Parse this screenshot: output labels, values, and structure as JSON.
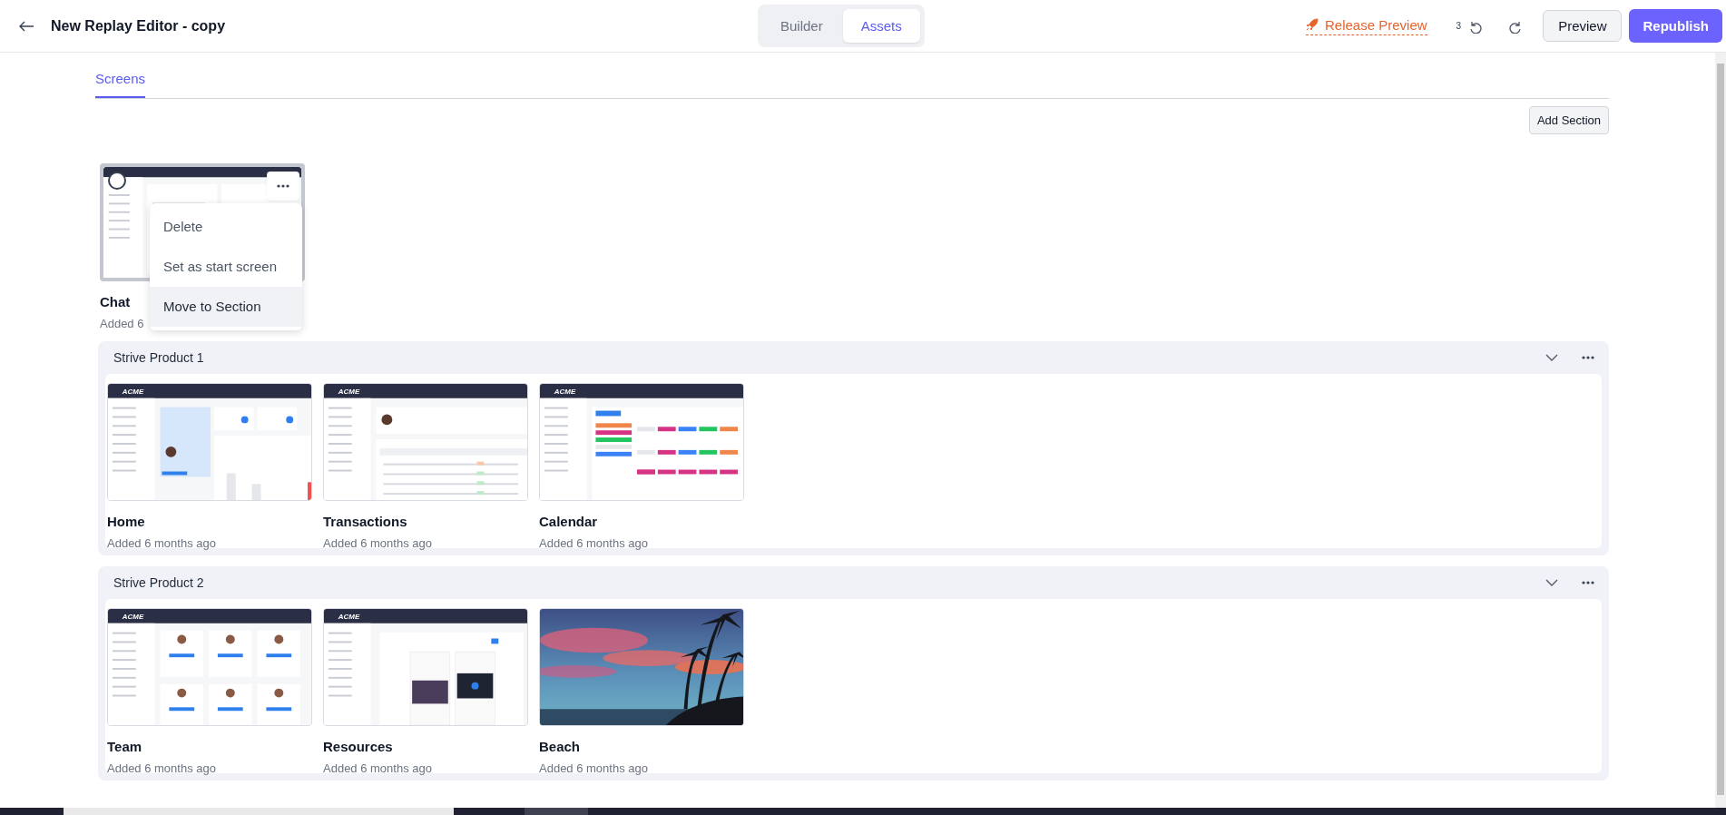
{
  "header": {
    "title": "New Replay Editor - copy",
    "mode_tabs": [
      {
        "label": "Builder",
        "selected": false
      },
      {
        "label": "Assets",
        "selected": true
      }
    ],
    "release_preview": "Release Preview",
    "undo_count": "3",
    "preview_button": "Preview",
    "publish_button": "Republish"
  },
  "page_tabs": [
    {
      "label": "Screens",
      "selected": true
    }
  ],
  "add_section_button": "Add Section",
  "unsectioned": [
    {
      "title": "Chat",
      "subtitle": "Added 6",
      "kind": "chat",
      "selected": true,
      "menu": [
        {
          "label": "Delete",
          "selected": false
        },
        {
          "label": "Set as start screen",
          "selected": false
        },
        {
          "label": "Move to Section",
          "selected": true
        }
      ]
    }
  ],
  "sections": [
    {
      "title": "Strive Product 1",
      "expanded": true,
      "screens": [
        {
          "title": "Home",
          "subtitle": "Added 6 months ago",
          "kind": "dashboard",
          "logo": "ACME",
          "selected": false
        },
        {
          "title": "Transactions",
          "subtitle": "Added 6 months ago",
          "kind": "table",
          "logo": "ACME",
          "selected": false
        },
        {
          "title": "Calendar",
          "subtitle": "Added 6 months ago",
          "kind": "calendar",
          "logo": "ACME",
          "selected": false
        }
      ]
    },
    {
      "title": "Strive Product 2",
      "expanded": true,
      "screens": [
        {
          "title": "Team",
          "subtitle": "Added 6 months ago",
          "kind": "cards",
          "logo": "ACME",
          "selected": false
        },
        {
          "title": "Resources",
          "subtitle": "Added 6 months ago",
          "kind": "articles",
          "logo": "ACME",
          "selected": false
        },
        {
          "title": "Beach",
          "subtitle": "Added 6 months ago",
          "kind": "picture",
          "selected": false
        }
      ]
    }
  ]
}
